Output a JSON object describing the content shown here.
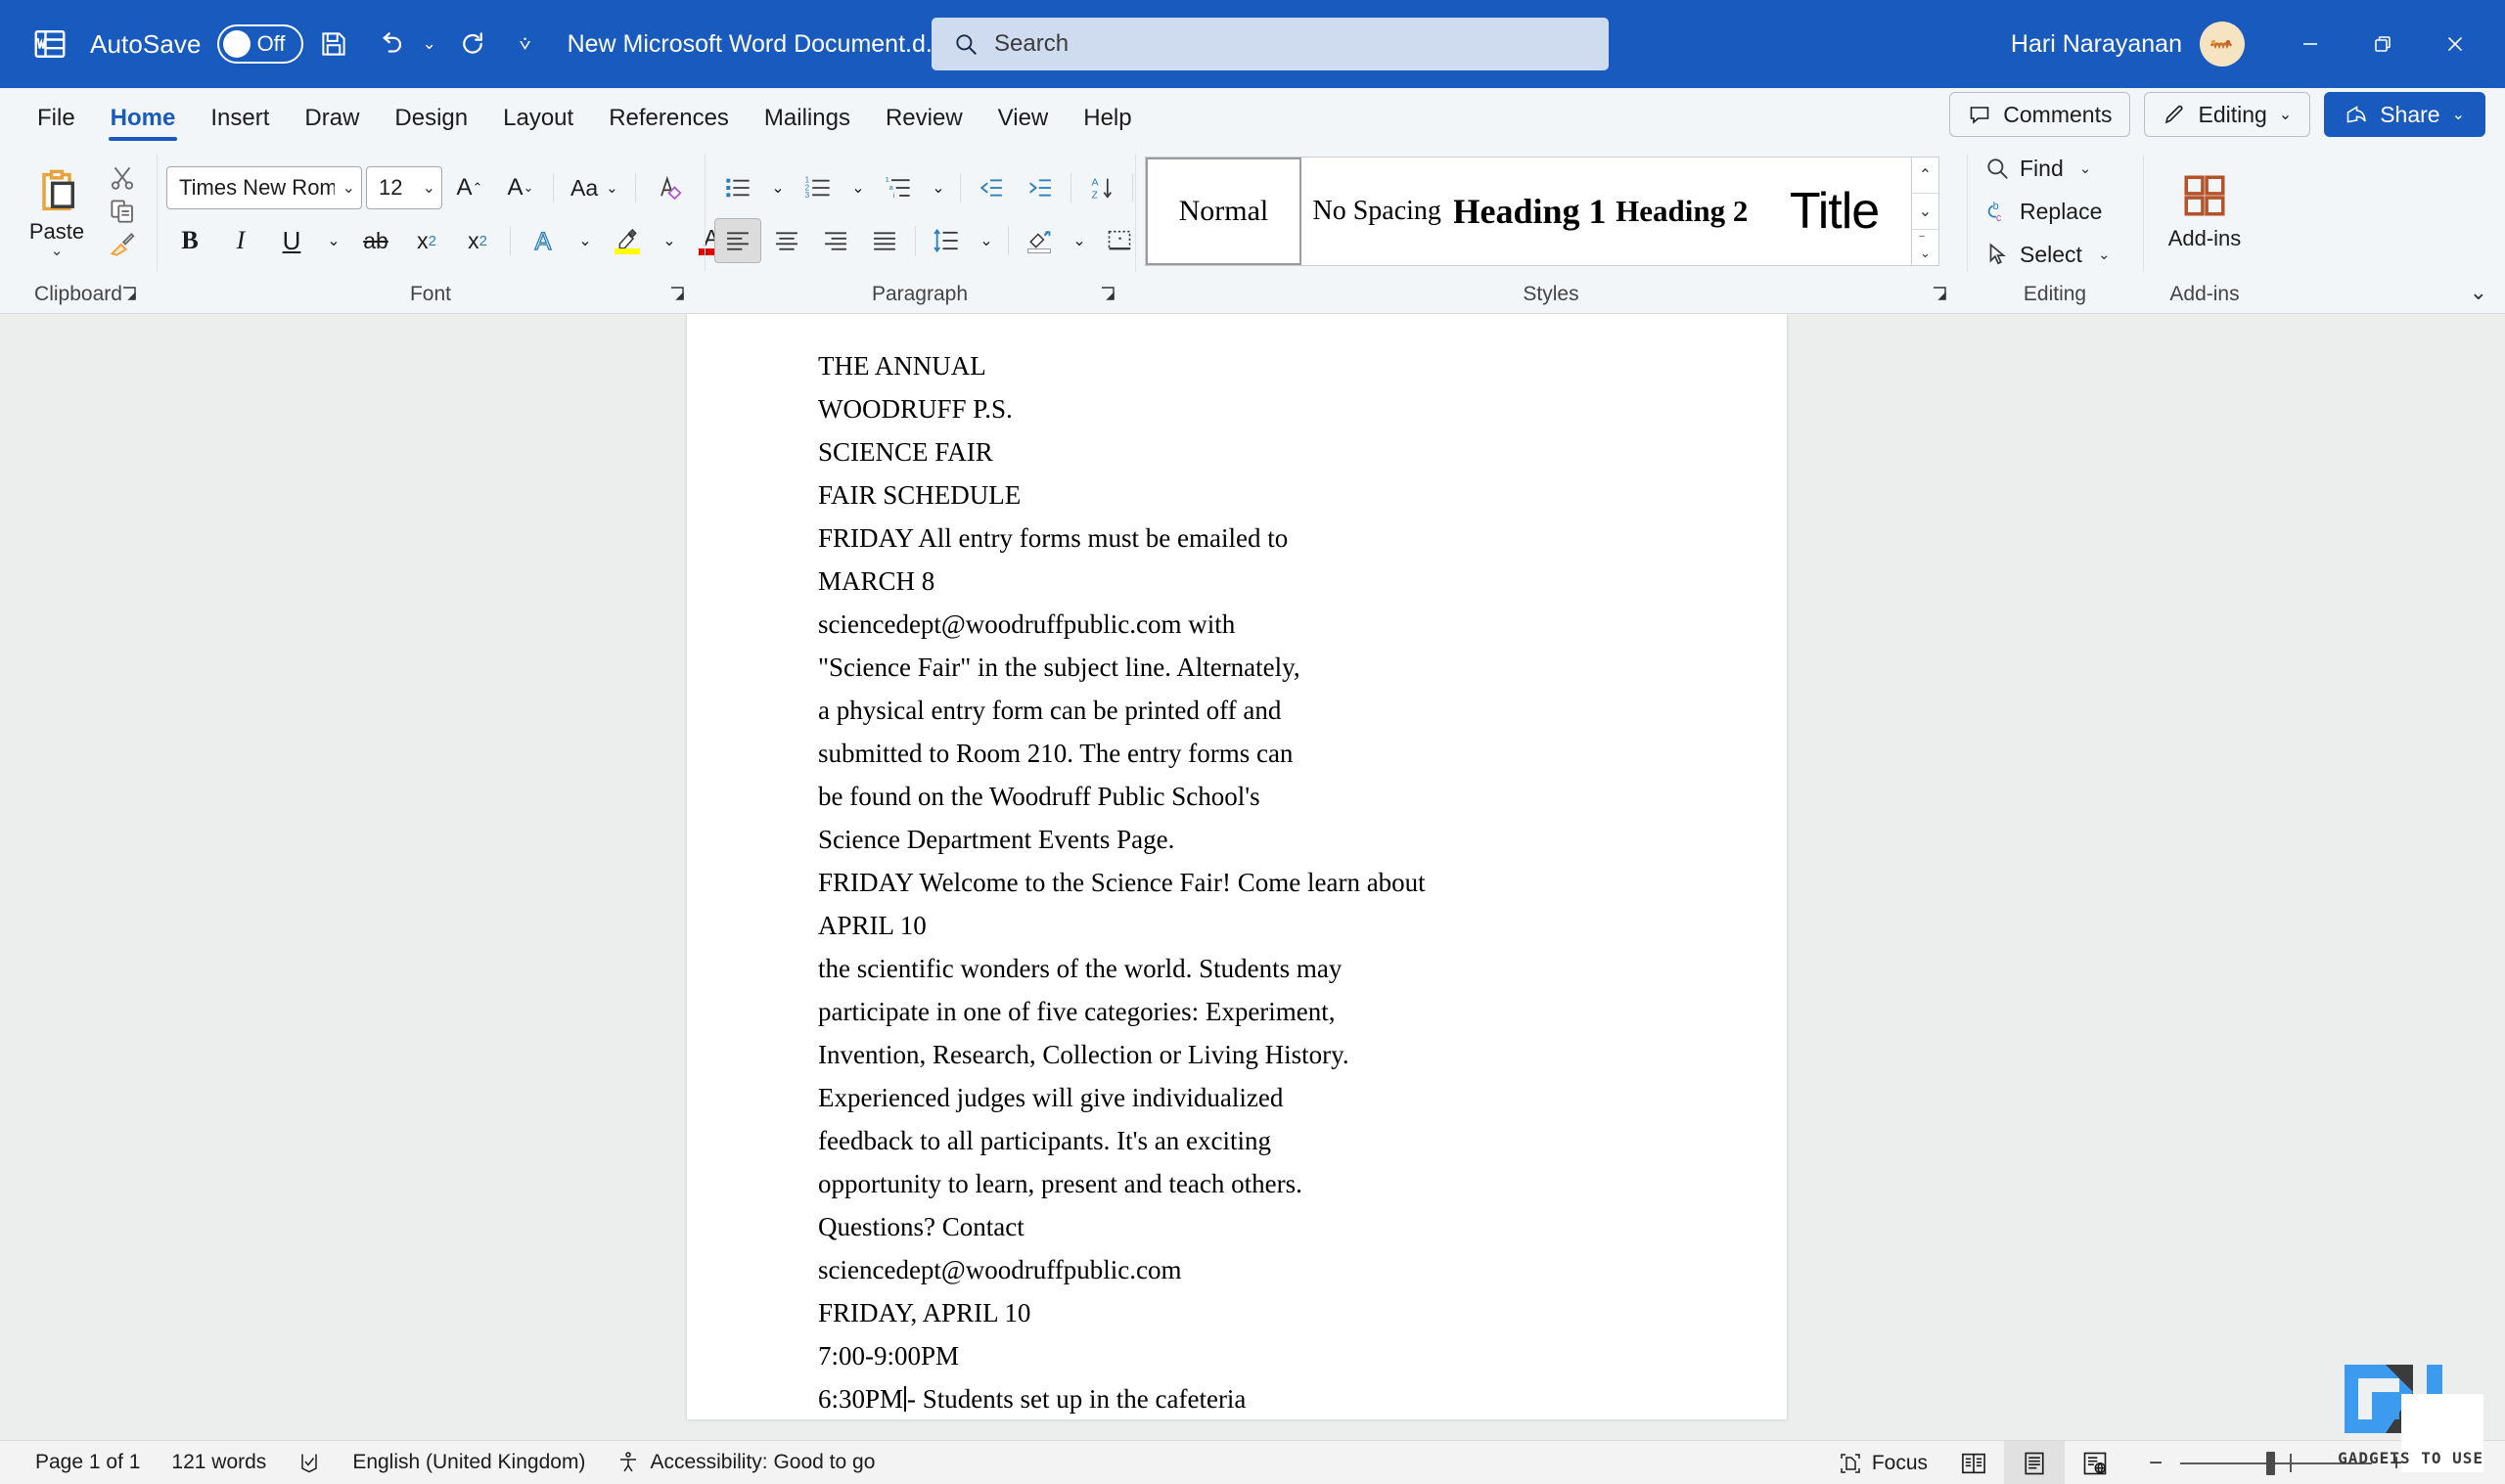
{
  "titlebar": {
    "app_icon": "word-icon",
    "autosave_label": "AutoSave",
    "autosave_state": "Off",
    "save_icon": "save-icon",
    "undo_icon": "undo-icon",
    "redo_icon": "redo-icon",
    "customize_qat_icon": "chevron-down-icon",
    "document_title": "New Microsoft Word Document.d...",
    "doc_title_caret": "chevron-down-icon",
    "search_placeholder": "Search",
    "search_value": "",
    "search_icon": "search-icon",
    "user_name": "Hari Narayanan",
    "avatar_initials": "",
    "minimize": "minimize-icon",
    "restore": "restore-icon",
    "close": "close-icon",
    "brand_color": "#185abd"
  },
  "tabs": [
    {
      "label": "File",
      "active": false
    },
    {
      "label": "Home",
      "active": true
    },
    {
      "label": "Insert",
      "active": false
    },
    {
      "label": "Draw",
      "active": false
    },
    {
      "label": "Design",
      "active": false
    },
    {
      "label": "Layout",
      "active": false
    },
    {
      "label": "References",
      "active": false
    },
    {
      "label": "Mailings",
      "active": false
    },
    {
      "label": "Review",
      "active": false
    },
    {
      "label": "View",
      "active": false
    },
    {
      "label": "Help",
      "active": false
    }
  ],
  "tabbar_right": {
    "comments_label": "Comments",
    "editing_label": "Editing",
    "editing_caret": "chevron-down-icon",
    "share_label": "Share",
    "share_caret": "chevron-down-icon"
  },
  "ribbon": {
    "clipboard": {
      "group_label": "Clipboard",
      "paste_label": "Paste",
      "paste_caret": "chevron-down-icon",
      "cut_icon": "scissors-icon",
      "copy_icon": "copy-icon",
      "format_painter_icon": "format-painter-icon",
      "dialog_launcher": "dialog-launcher-icon"
    },
    "font": {
      "group_label": "Font",
      "font_name": "Times New Roman",
      "font_size": "12",
      "grow_font": "A",
      "shrink_font": "A",
      "change_case": "Aa",
      "clear_formatting_icon": "clear-formatting-icon",
      "bold": "B",
      "italic": "I",
      "underline": "U",
      "strikethrough": "ab",
      "subscript": "x",
      "subscript_sub": "2",
      "superscript": "x",
      "superscript_sup": "2",
      "text_effects_icon": "text-effects-icon",
      "highlight_icon": "highlight-icon",
      "font_color_icon": "font-color-icon",
      "highlight_color": "#ffff00",
      "font_color": "#e00000",
      "dialog_launcher": "dialog-launcher-icon"
    },
    "paragraph": {
      "group_label": "Paragraph",
      "bullets_icon": "bullets-icon",
      "numbering_icon": "numbering-icon",
      "multilevel_icon": "multilevel-list-icon",
      "decrease_indent_icon": "decrease-indent-icon",
      "increase_indent_icon": "increase-indent-icon",
      "sort_icon": "sort-icon",
      "show_marks_icon": "pilcrow-icon",
      "align_left_icon": "align-left-icon",
      "align_center_icon": "align-center-icon",
      "align_right_icon": "align-right-icon",
      "justify_icon": "justify-icon",
      "line_spacing_icon": "line-spacing-icon",
      "shading_icon": "shading-icon",
      "borders_icon": "borders-icon",
      "dialog_launcher": "dialog-launcher-icon"
    },
    "styles": {
      "group_label": "Styles",
      "items": [
        {
          "label": "Normal",
          "selected": true
        },
        {
          "label": "No Spacing",
          "selected": false
        },
        {
          "label": "Heading 1",
          "selected": false
        },
        {
          "label": "Heading 2",
          "selected": false
        },
        {
          "label": "Title",
          "selected": false
        }
      ],
      "scroll_up": "chevron-up-icon",
      "scroll_down": "chevron-down-icon",
      "more": "more-styles-icon",
      "dialog_launcher": "dialog-launcher-icon"
    },
    "editing": {
      "group_label": "Editing",
      "find_label": "Find",
      "find_caret": "chevron-down-icon",
      "replace_label": "Replace",
      "select_label": "Select",
      "select_caret": "chevron-down-icon"
    },
    "addins": {
      "group_label": "Add-ins",
      "button_label": "Add-ins",
      "icon": "addins-grid-icon"
    },
    "collapse_ribbon": "chevron-down-icon"
  },
  "document": {
    "lines": [
      "THE ANNUAL",
      "WOODRUFF P.S.",
      "SCIENCE FAIR",
      "FAIR SCHEDULE",
      "FRIDAY All entry forms must be emailed to",
      "MARCH 8",
      "sciencedept@woodruffpublic.com with",
      "\"Science Fair\" in the subject line. Alternately,",
      "a physical entry form can be printed off and",
      "submitted to Room 210. The entry forms can",
      "be found on the Woodruff Public School's",
      "Science Department Events Page.",
      "FRIDAY Welcome to the Science Fair! Come learn about",
      "APRIL 10",
      "the scientific wonders of the world. Students may",
      "participate in one of five categories: Experiment,",
      "Invention, Research, Collection or Living History.",
      "Experienced judges will give individualized",
      "feedback to all participants. It's an exciting",
      "opportunity to learn, present and teach others.",
      "Questions? Contact",
      "sciencedept@woodruffpublic.com",
      "FRIDAY, APRIL 10",
      "7:00-9:00PM"
    ],
    "caret_line_before": "6:30PM",
    "caret_line_after": "- Students set up in the cafeteria"
  },
  "statusbar": {
    "page_info": "Page 1 of 1",
    "word_count": "121 words",
    "proofing_icon": "proofing-icon",
    "language": "English (United Kingdom)",
    "accessibility_icon": "accessibility-icon",
    "accessibility": "Accessibility: Good to go",
    "focus_label": "Focus",
    "focus_icon": "focus-icon",
    "read_mode_icon": "read-mode-icon",
    "print_layout_icon": "print-layout-icon",
    "web_layout_icon": "web-layout-icon",
    "zoom_out": "−",
    "zoom_in": "+",
    "zoom_level": ""
  },
  "watermark": {
    "text": "GADGETS TO USE",
    "colors": {
      "blue": "#3d9bef",
      "dark": "#3b3b3b"
    }
  }
}
